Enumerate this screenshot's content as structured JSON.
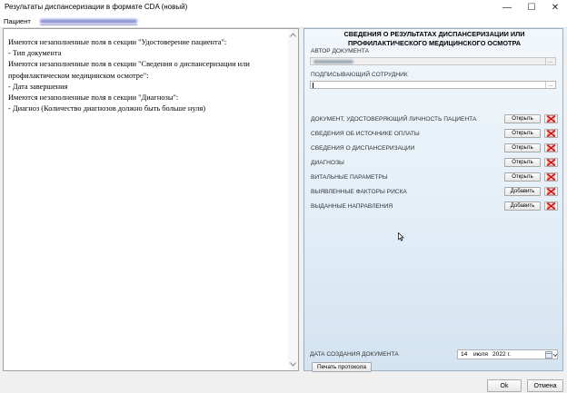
{
  "window": {
    "title": "Результаты диспансеризации в формате CDA (новый)",
    "controls": {
      "minimize": "—",
      "maximize": "☐",
      "close": "✕"
    }
  },
  "patient": {
    "label": "Пациент"
  },
  "messages": [
    "Имеются незаполненные поля в секции \"Удостоверение пациента\":",
    "- Тип документа",
    "Имеются незаполненные поля в секции \"Сведения о диспансеризации или профилактическом медицинском осмотре\":",
    "- Дата завершения",
    "Имеются незаполненные поля в секции \"Диагнозы\":",
    "- Диагноз (Количество диагнозов должно быть больше нуля)"
  ],
  "panel": {
    "title": "СВЕДЕНИЯ О РЕЗУЛЬТАТАХ ДИСПАНСЕРИЗАЦИИ ИЛИ ПРОФИЛАКТИЧЕСКОГО МЕДИЦИНСКОГО ОСМОТРА",
    "author_label": "АВТОР ДОКУМЕНТА",
    "signer_label": "ПОДПИСЫВАЮЩИЙ СОТРУДНИК",
    "field_button": "...",
    "sections": [
      {
        "label": "ДОКУМЕНТ, УДОСТОВЕРЯЮЩИЙ ЛИЧНОСТЬ ПАЦИЕНТА",
        "action": "Открыть"
      },
      {
        "label": "СВЕДЕНИЯ ОБ ИСТОЧНИКЕ ОПЛАТЫ",
        "action": "Открыть"
      },
      {
        "label": "СВЕДЕНИЯ О ДИСПАНСЕРИЗАЦИИ",
        "action": "Открыть"
      },
      {
        "label": "ДИАГНОЗЫ",
        "action": "Открыть"
      },
      {
        "label": "ВИТАЛЬНЫЕ ПАРАМЕТРЫ",
        "action": "Открыть"
      },
      {
        "label": "ВЫЯВЛЕННЫЕ ФАКТОРЫ РИСКА",
        "action": "Добавить"
      },
      {
        "label": "ВЫДАННЫЕ НАПРАВЛЕНИЯ",
        "action": "Добавить"
      }
    ],
    "delete_icon": "delete-icon",
    "date_label": "ДАТА СОЗДАНИЯ ДОКУМЕНТА",
    "date": {
      "day": "14",
      "month": "июля",
      "year": "2022 г."
    },
    "print_button": "Печать протокола"
  },
  "buttons": {
    "ok": "Ok",
    "cancel": "Отмена"
  }
}
